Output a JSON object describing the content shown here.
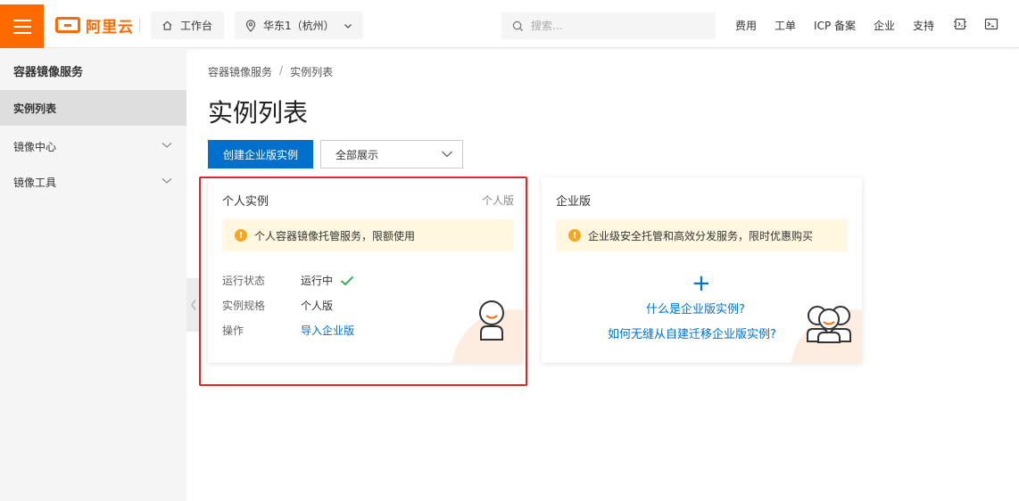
{
  "header": {
    "logo_text": "阿里云",
    "workbench_label": "工作台",
    "region_label": "华东1（杭州）",
    "search_placeholder": "搜索...",
    "links": [
      "费用",
      "工单",
      "ICP 备案",
      "企业",
      "支持"
    ]
  },
  "sidebar": {
    "title": "容器镜像服务",
    "items": [
      {
        "label": "实例列表"
      },
      {
        "label": "镜像中心"
      },
      {
        "label": "镜像工具"
      }
    ]
  },
  "breadcrumb": {
    "root": "容器镜像服务",
    "sep": "/",
    "current": "实例列表"
  },
  "page": {
    "title": "实例列表",
    "create_button": "创建企业版实例",
    "filter_value": "全部展示"
  },
  "personal_card": {
    "title": "个人实例",
    "tag": "个人版",
    "notice": "个人容器镜像托管服务，限额使用",
    "rows": [
      {
        "key": "运行状态",
        "value": "运行中"
      },
      {
        "key": "实例规格",
        "value": "个人版"
      },
      {
        "key": "操作",
        "value": "导入企业版"
      }
    ]
  },
  "enterprise_card": {
    "title": "企业版",
    "notice": "企业级安全托管和高效分发服务，限时优惠购买",
    "plus": "+",
    "link1": "什么是企业版实例?",
    "link2": "如何无缝从自建迁移企业版实例?"
  },
  "colors": {
    "accent": "#ff6a00",
    "primary": "#0070cc",
    "highlight": "#e32424",
    "success": "#1fa83b"
  }
}
